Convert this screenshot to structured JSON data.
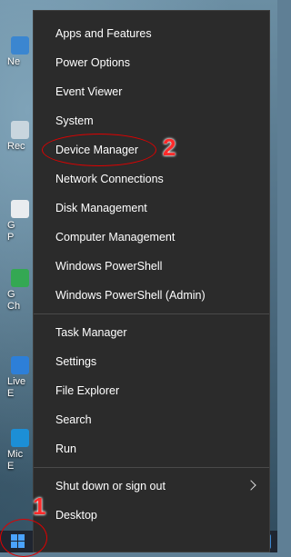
{
  "menu": {
    "groups": [
      [
        "Apps and Features",
        "Power Options",
        "Event Viewer",
        "System",
        "Device Manager",
        "Network Connections",
        "Disk Management",
        "Computer Management",
        "Windows PowerShell",
        "Windows PowerShell (Admin)"
      ],
      [
        "Task Manager",
        "Settings",
        "File Explorer",
        "Search",
        "Run"
      ],
      [
        "Shut down or sign out",
        "Desktop"
      ]
    ]
  },
  "desktop_icons": [
    {
      "label": "Ne"
    },
    {
      "label": "Rec"
    },
    {
      "label": "G"
    },
    {
      "label": "P"
    },
    {
      "label": "G"
    },
    {
      "label": "Ch"
    },
    {
      "label": "Live"
    },
    {
      "label": "E"
    },
    {
      "label": "Mic"
    },
    {
      "label": "E"
    }
  ],
  "annotations": {
    "step1": "1",
    "step2": "2"
  },
  "colors": {
    "menu_bg": "#2b2b2b",
    "annotation_red": "#e00000"
  }
}
